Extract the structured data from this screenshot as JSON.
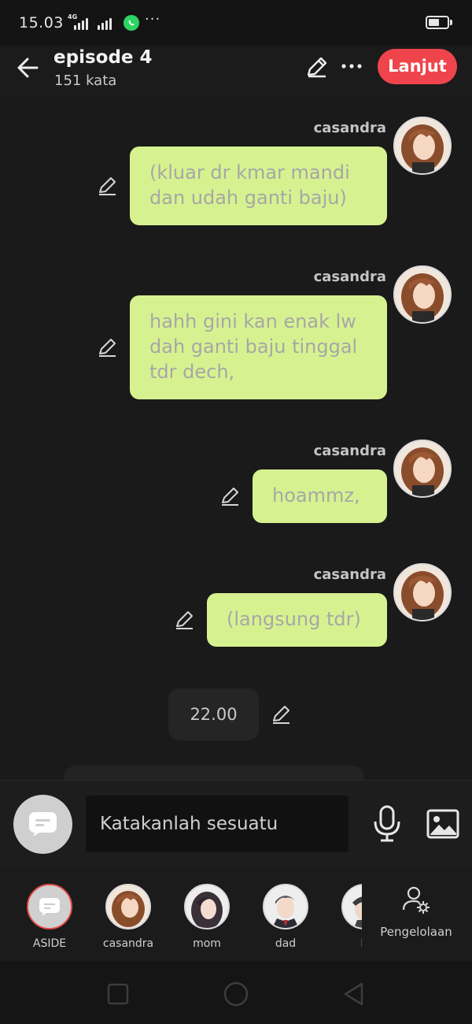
{
  "status_bar": {
    "time": "15.03",
    "network": "4G",
    "icons": [
      "signal-icon",
      "whatsapp-icon",
      "more-notifications-icon",
      "battery-icon"
    ],
    "battery_level": 0.6
  },
  "header": {
    "title": "episode 4",
    "subtitle": "151 kata",
    "next_label": "Lanjut",
    "accent": "#f0444c"
  },
  "messages": [
    {
      "speaker": "casandra",
      "text": "(kluar dr kmar mandi dan udah ganti baju)"
    },
    {
      "speaker": "casandra",
      "text": "hahh gini kan enak lw dah ganti baju tinggal tdr dech,"
    },
    {
      "speaker": "casandra",
      "text": "hoammz,"
    },
    {
      "speaker": "casandra",
      "text": "(langsung tdr)"
    }
  ],
  "narration": {
    "text": "22.00"
  },
  "composer": {
    "placeholder": "Katakanlah sesuatu",
    "bubble_color": "#d6f290"
  },
  "characters": [
    {
      "name": "ASIDE"
    },
    {
      "name": "casandra"
    },
    {
      "name": "mom"
    },
    {
      "name": "dad"
    },
    {
      "name": "b"
    }
  ],
  "manage_label": "Pengelolaan",
  "nav_icons": [
    "recents-square-icon",
    "home-circle-icon",
    "back-triangle-icon"
  ]
}
